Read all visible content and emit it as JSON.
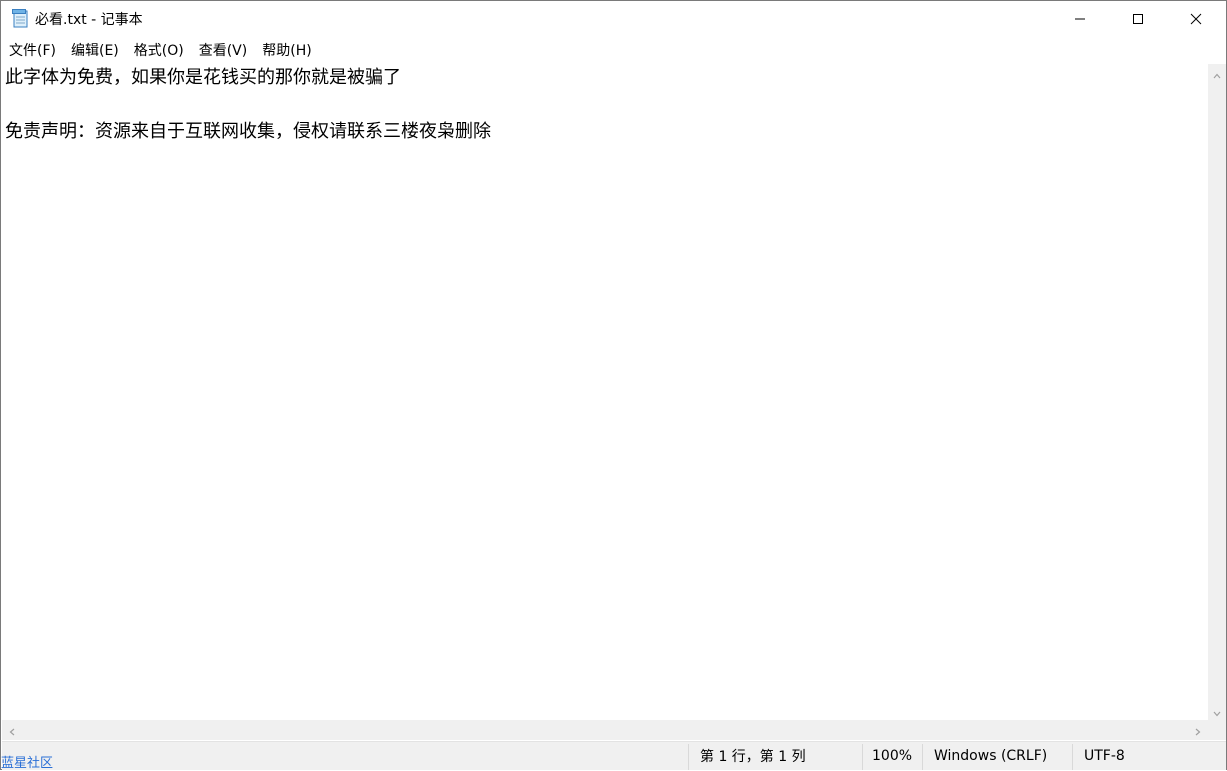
{
  "window": {
    "title": "必看.txt - 记事本"
  },
  "menu": {
    "items": [
      "文件(F)",
      "编辑(E)",
      "格式(O)",
      "查看(V)",
      "帮助(H)"
    ]
  },
  "editor": {
    "lines": [
      "此字体为免费，如果你是花钱买的那你就是被骗了",
      "",
      "免责声明：资源来自于互联网收集，侵权请联系三楼夜枭删除"
    ]
  },
  "status": {
    "position": "第 1 行，第 1 列",
    "zoom": "100%",
    "line_ending": "Windows (CRLF)",
    "encoding": "UTF-8"
  },
  "watermark": {
    "text": "蓝星社区"
  },
  "icons": {
    "app": "notepad-icon",
    "minimize": "minimize-icon",
    "maximize": "maximize-icon",
    "close": "close-icon"
  }
}
